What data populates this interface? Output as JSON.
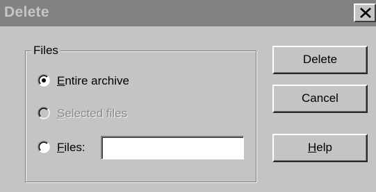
{
  "window": {
    "title": "Delete",
    "close_icon": "close-x-icon"
  },
  "group": {
    "label": "Files"
  },
  "options": {
    "entire_archive": {
      "accel": "E",
      "rest": "ntire archive",
      "checked": true,
      "enabled": true
    },
    "selected_files": {
      "accel": "S",
      "rest": "elected files",
      "checked": false,
      "enabled": false
    },
    "files": {
      "accel": "F",
      "rest": "iles:",
      "checked": false,
      "enabled": true
    }
  },
  "files_input": {
    "value": "",
    "placeholder": ""
  },
  "buttons": {
    "delete": "Delete",
    "cancel": "Cancel",
    "help_accel": "H",
    "help_rest": "elp"
  },
  "colors": {
    "face": "#c4c4c4",
    "title_bar": "#828282",
    "title_text": "#c6c6c6",
    "disabled_text": "#8a8a8a"
  }
}
